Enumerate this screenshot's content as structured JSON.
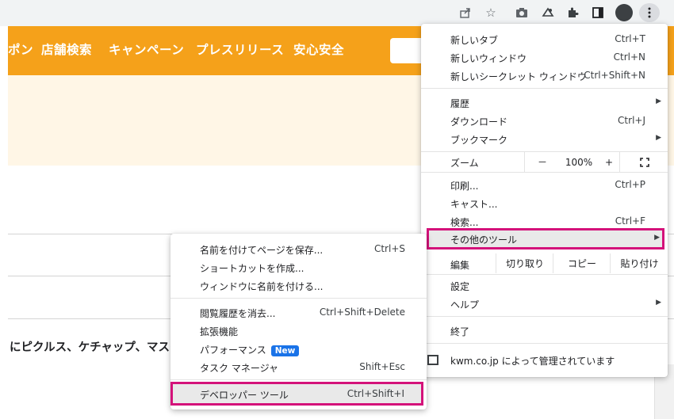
{
  "toolbar": {
    "icons": [
      "share-icon",
      "star-icon",
      "camera-icon",
      "extension-shield-icon",
      "puzzle-icon",
      "sidepanel-icon",
      "avatar",
      "kebab-menu-icon"
    ]
  },
  "site": {
    "nav_items": [
      "ポン",
      "店舗検索",
      "キャンペーン",
      "プレスリリース",
      "安心安全"
    ],
    "body_text": "にピクルス、ケチャップ、マスタ"
  },
  "main_menu": {
    "new_tab": {
      "label": "新しいタブ",
      "shortcut": "Ctrl+T"
    },
    "new_window": {
      "label": "新しいウィンドウ",
      "shortcut": "Ctrl+N"
    },
    "new_incognito": {
      "label": "新しいシークレット ウィンドウ",
      "shortcut": "Ctrl+Shift+N"
    },
    "history": {
      "label": "履歴"
    },
    "downloads": {
      "label": "ダウンロード",
      "shortcut": "Ctrl+J"
    },
    "bookmarks": {
      "label": "ブックマーク"
    },
    "zoom": {
      "label": "ズーム",
      "minus": "－",
      "value": "100%",
      "plus": "+"
    },
    "print": {
      "label": "印刷...",
      "shortcut": "Ctrl+P"
    },
    "cast": {
      "label": "キャスト..."
    },
    "find": {
      "label": "検索...",
      "shortcut": "Ctrl+F"
    },
    "more_tools": {
      "label": "その他のツール"
    },
    "edit": {
      "label": "編集",
      "cut": "切り取り",
      "copy": "コピー",
      "paste": "貼り付け"
    },
    "settings": {
      "label": "設定"
    },
    "help": {
      "label": "ヘルプ"
    },
    "exit": {
      "label": "終了"
    },
    "managed": {
      "label": "kwm.co.jp によって管理されています"
    }
  },
  "sub_menu": {
    "save_page": {
      "label": "名前を付けてページを保存...",
      "shortcut": "Ctrl+S"
    },
    "create_shortcut": {
      "label": "ショートカットを作成..."
    },
    "name_window": {
      "label": "ウィンドウに名前を付ける..."
    },
    "clear_data": {
      "label": "閲覧履歴を消去...",
      "shortcut": "Ctrl+Shift+Delete"
    },
    "extensions": {
      "label": "拡張機能"
    },
    "performance": {
      "label": "パフォーマンス",
      "badge": "New"
    },
    "task_manager": {
      "label": "タスク マネージャ",
      "shortcut": "Shift+Esc"
    },
    "dev_tools": {
      "label": "デベロッパー ツール",
      "shortcut": "Ctrl+Shift+I"
    }
  },
  "colors": {
    "site_orange": "#f5a11a",
    "highlight_border": "#d4127a",
    "new_badge": "#1a73e8"
  }
}
